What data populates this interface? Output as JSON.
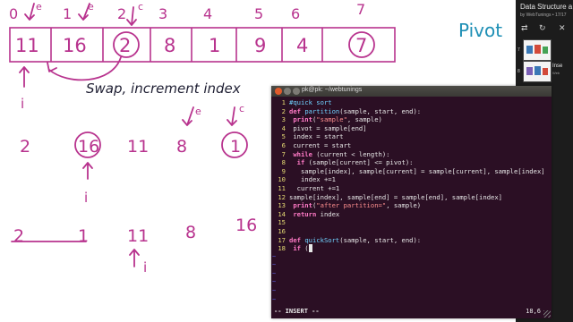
{
  "whiteboard": {
    "index_labels": [
      "0",
      "1",
      "2",
      "3",
      "4",
      "5",
      "6",
      "7"
    ],
    "array_values": [
      "11",
      "16",
      "2",
      "8",
      "1",
      "9",
      "4",
      "7"
    ],
    "marker_e": "e",
    "marker_c": "c",
    "marker_i": "i",
    "pivot_label": "Pivot",
    "note_swap": "Swap, increment index",
    "row2_values": [
      "2",
      "16",
      "11",
      "8",
      "1"
    ],
    "row3_values": [
      "2",
      "1",
      "11",
      "8",
      "16"
    ]
  },
  "playlist": {
    "title": "Data Structure a",
    "subtitle": "by WebTunings • 17/17",
    "controls": [
      "⇄",
      "↻",
      "✕"
    ],
    "items": [
      {
        "number": "7",
        "label": "",
        "sublabel": ""
      },
      {
        "number": "8",
        "label": "Inse",
        "sublabel": "Web"
      }
    ]
  },
  "terminal": {
    "title": "pk@pk: ~/webtunings",
    "mode": "-- INSERT --",
    "cursor_position": "18,6",
    "lines": [
      {
        "num": "1",
        "parts": [
          {
            "c": "cm",
            "t": "#quick sort"
          }
        ]
      },
      {
        "num": "2",
        "parts": [
          {
            "c": "kw",
            "t": "def"
          },
          {
            "c": "t",
            "t": " "
          },
          {
            "c": "fn",
            "t": "partition"
          },
          {
            "c": "t",
            "t": "(sample, start, end):"
          }
        ]
      },
      {
        "num": "3",
        "parts": [
          {
            "c": "t",
            "t": " "
          },
          {
            "c": "kw",
            "t": "print"
          },
          {
            "c": "t",
            "t": "("
          },
          {
            "c": "st",
            "t": "\"sample\""
          },
          {
            "c": "t",
            "t": ", sample)"
          }
        ]
      },
      {
        "num": "4",
        "parts": [
          {
            "c": "t",
            "t": " pivot = sample[end]"
          }
        ]
      },
      {
        "num": "5",
        "parts": [
          {
            "c": "t",
            "t": " index = start"
          }
        ]
      },
      {
        "num": "6",
        "parts": [
          {
            "c": "t",
            "t": " current = start"
          }
        ]
      },
      {
        "num": "7",
        "parts": [
          {
            "c": "t",
            "t": " "
          },
          {
            "c": "kw",
            "t": "while"
          },
          {
            "c": "t",
            "t": " (current < length):"
          }
        ]
      },
      {
        "num": "8",
        "parts": [
          {
            "c": "t",
            "t": "  "
          },
          {
            "c": "kw",
            "t": "if"
          },
          {
            "c": "t",
            "t": " (sample[current] <= pivot):"
          }
        ]
      },
      {
        "num": "9",
        "parts": [
          {
            "c": "t",
            "t": "   sample[index], sample[current] = sample[current], sample[index]"
          }
        ]
      },
      {
        "num": "10",
        "parts": [
          {
            "c": "t",
            "t": "   index +=1"
          }
        ]
      },
      {
        "num": "11",
        "parts": [
          {
            "c": "t",
            "t": "  current +=1"
          }
        ]
      },
      {
        "num": "12",
        "parts": [
          {
            "c": "t",
            "t": "sample[index], sample[end] = sample[end], sample[index]"
          }
        ]
      },
      {
        "num": "13",
        "parts": [
          {
            "c": "t",
            "t": " "
          },
          {
            "c": "kw",
            "t": "print"
          },
          {
            "c": "t",
            "t": "("
          },
          {
            "c": "st",
            "t": "\"after partition=\""
          },
          {
            "c": "t",
            "t": ", sample)"
          }
        ]
      },
      {
        "num": "14",
        "parts": [
          {
            "c": "t",
            "t": " "
          },
          {
            "c": "kw",
            "t": "return"
          },
          {
            "c": "t",
            "t": " index"
          }
        ]
      },
      {
        "num": "15",
        "parts": []
      },
      {
        "num": "16",
        "parts": []
      },
      {
        "num": "17",
        "parts": [
          {
            "c": "kw",
            "t": "def"
          },
          {
            "c": "t",
            "t": " "
          },
          {
            "c": "fn",
            "t": "quickSort"
          },
          {
            "c": "t",
            "t": "(sample, start, end):"
          }
        ]
      },
      {
        "num": "18",
        "parts": [
          {
            "c": "t",
            "t": " "
          },
          {
            "c": "kw",
            "t": "if"
          },
          {
            "c": "t",
            "t": " ("
          },
          {
            "c": "cursor",
            "t": " "
          }
        ]
      }
    ],
    "empty_marker": "~"
  },
  "colors": {
    "marker_ink": "#b8338e",
    "dark_ink": "#1f1f33",
    "pivot_blue": "#1e8fb5",
    "terminal_bg": "#2b0f24",
    "keyword": "#ff7ac6",
    "function": "#6fd2ff",
    "string": "#ff8f8f",
    "line_number": "#e6db74"
  }
}
